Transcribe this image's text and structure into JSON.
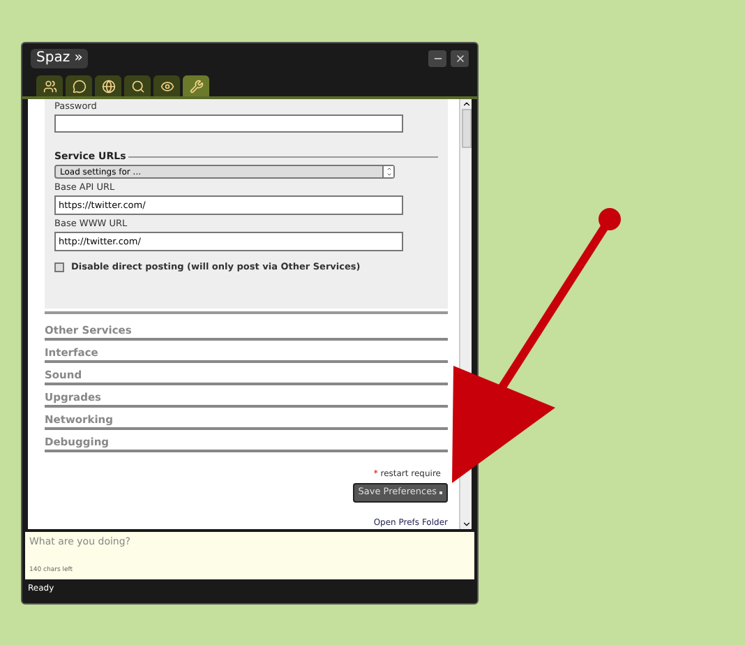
{
  "window": {
    "title_button": "Spaz »"
  },
  "tabs": [
    {
      "kind": "people",
      "selected": false
    },
    {
      "kind": "chat",
      "selected": false
    },
    {
      "kind": "globe",
      "selected": false
    },
    {
      "kind": "search",
      "selected": false
    },
    {
      "kind": "eye",
      "selected": false
    },
    {
      "kind": "tools",
      "selected": true
    }
  ],
  "form": {
    "password_label": "Password",
    "legend": "Service URLs",
    "select_value": "Load settings for ...",
    "fields": [
      {
        "label": "Base API URL",
        "value": "https://twitter.com/"
      },
      {
        "label": "Base WWW URL",
        "value": "http://twitter.com/"
      }
    ],
    "checkbox": {
      "label": "Disable direct posting (will only post via Other Services)",
      "checked": false
    }
  },
  "sections": [
    "Other Services",
    "Interface",
    "Sound",
    "Upgrades",
    "Networking",
    "Debugging"
  ],
  "restart_note": {
    "mark": "*",
    "text": "restart require"
  },
  "save_button": "Save Preferences",
  "prefs_link": "Open Prefs Folder",
  "composer": {
    "placeholder": "What are you doing?",
    "counter": "140 chars left"
  },
  "status_bar": "Ready"
}
